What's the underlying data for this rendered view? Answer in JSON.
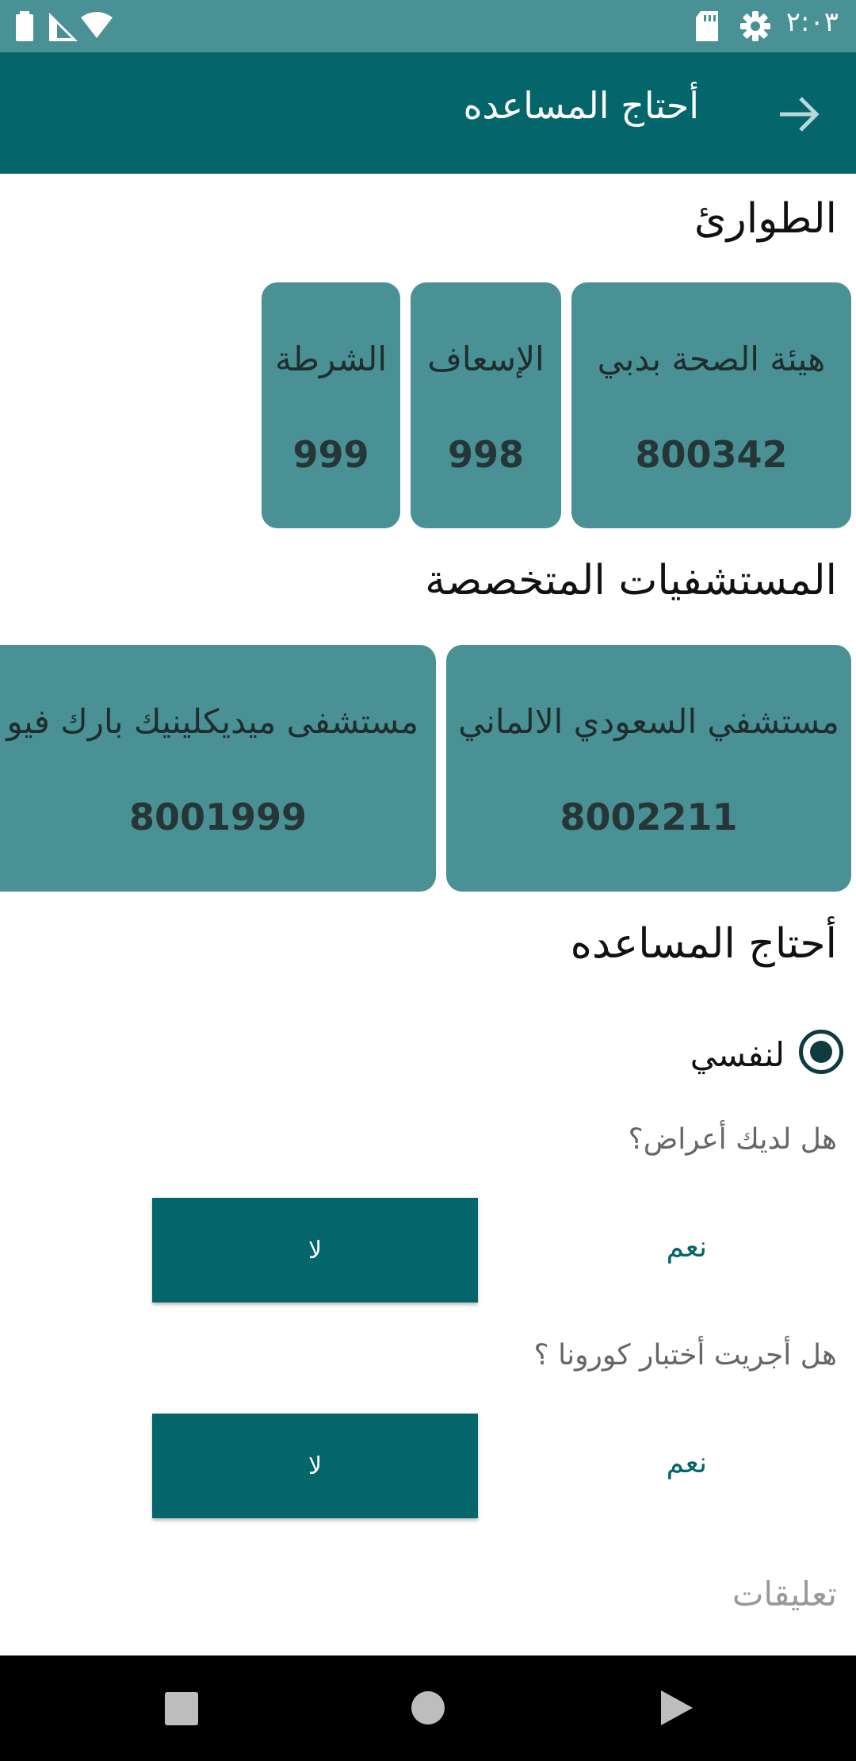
{
  "status_bar": {
    "time": "٢:٠٣",
    "icons": [
      "battery-icon",
      "signal-icon",
      "wifi-icon",
      "sd-card-icon",
      "settings-gear-icon"
    ]
  },
  "app_bar": {
    "title": "أحتاج المساعده",
    "back_icon": "arrow-right-icon"
  },
  "emergency": {
    "title": "الطوارئ",
    "cards": [
      {
        "name": "هيئة الصحة بدبي",
        "number": "800342"
      },
      {
        "name": "الإسعاف",
        "number": "998"
      },
      {
        "name": "الشرطة",
        "number": "999"
      }
    ]
  },
  "hospitals": {
    "title": "المستشفيات المتخصصة",
    "cards": [
      {
        "name": "مستشفي السعودي الالماني",
        "number": "8002211"
      },
      {
        "name": "مستشفى ميديكلينيك بارك فيو",
        "number": "8001999"
      }
    ]
  },
  "help": {
    "title": "أحتاج المساعده",
    "radio_label": "لنفسي",
    "q1": {
      "question": "هل لديك أعراض؟",
      "yes": "نعم",
      "no": "لا"
    },
    "q2": {
      "question": "هل أجريت أختبار كورونا ؟",
      "yes": "نعم",
      "no": "لا"
    },
    "comments_placeholder": "تعليقات"
  },
  "colors": {
    "status_bar": "#4a9195",
    "app_bar": "#04666a",
    "card": "#4a9195",
    "button": "#04666a"
  }
}
